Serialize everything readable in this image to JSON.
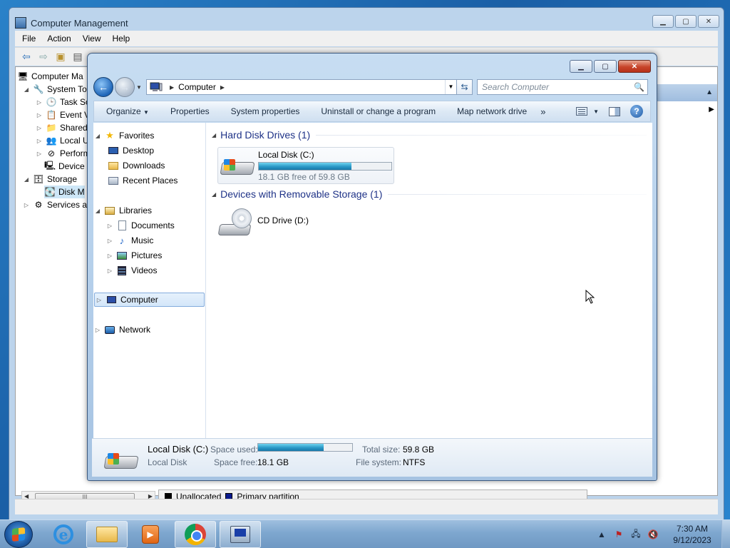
{
  "computer_management": {
    "title": "Computer Management",
    "menu": [
      "File",
      "Action",
      "View",
      "Help"
    ],
    "tree": [
      {
        "label": "Computer Ma",
        "icon": "computer-management-icon"
      },
      {
        "label": "System To",
        "icon": "tools-icon"
      },
      {
        "label": "Task Sc",
        "icon": "clock-icon"
      },
      {
        "label": "Event V",
        "icon": "event-viewer-icon"
      },
      {
        "label": "Shared",
        "icon": "shared-folder-icon"
      },
      {
        "label": "Local U",
        "icon": "users-icon"
      },
      {
        "label": "Perform",
        "icon": "performance-icon"
      },
      {
        "label": "Device",
        "icon": "device-manager-icon"
      },
      {
        "label": "Storage",
        "icon": "storage-icon"
      },
      {
        "label": "Disk M",
        "icon": "disk-management-icon"
      },
      {
        "label": "Services an",
        "icon": "services-icon"
      }
    ],
    "legend": [
      {
        "label": "Unallocated",
        "color": "#000000"
      },
      {
        "label": "Primary partition",
        "color": "#0a1a8c"
      }
    ],
    "scroll_thumb": "III"
  },
  "explorer": {
    "address": {
      "crumb": "Computer"
    },
    "search_placeholder": "Search Computer",
    "commands": [
      "Organize",
      "Properties",
      "System properties",
      "Uninstall or change a program",
      "Map network drive"
    ],
    "more": "»",
    "nav": {
      "favorites": "Favorites",
      "favorites_items": [
        "Desktop",
        "Downloads",
        "Recent Places"
      ],
      "libraries": "Libraries",
      "libraries_items": [
        "Documents",
        "Music",
        "Pictures",
        "Videos"
      ],
      "computer": "Computer",
      "network": "Network"
    },
    "groups": {
      "hdd": "Hard Disk Drives (1)",
      "removable": "Devices with Removable Storage (1)"
    },
    "drive_c": {
      "name": "Local Disk (C:)",
      "free_text": "18.1 GB free of 59.8 GB",
      "used_fraction": 0.697
    },
    "drive_d": {
      "name": "CD Drive (D:)"
    },
    "details": {
      "name": "Local Disk (C:)",
      "type": "Local Disk",
      "space_used_label": "Space used:",
      "space_free_label": "Space free:",
      "space_free": "18.1 GB",
      "total_size_label": "Total size:",
      "total_size": "59.8 GB",
      "fs_label": "File system:",
      "fs": "NTFS"
    }
  },
  "taskbar": {
    "time": "7:30 AM",
    "date": "9/12/2023",
    "apps": [
      "internet-explorer",
      "windows-explorer",
      "windows-media-player",
      "google-chrome",
      "computer-management"
    ]
  }
}
